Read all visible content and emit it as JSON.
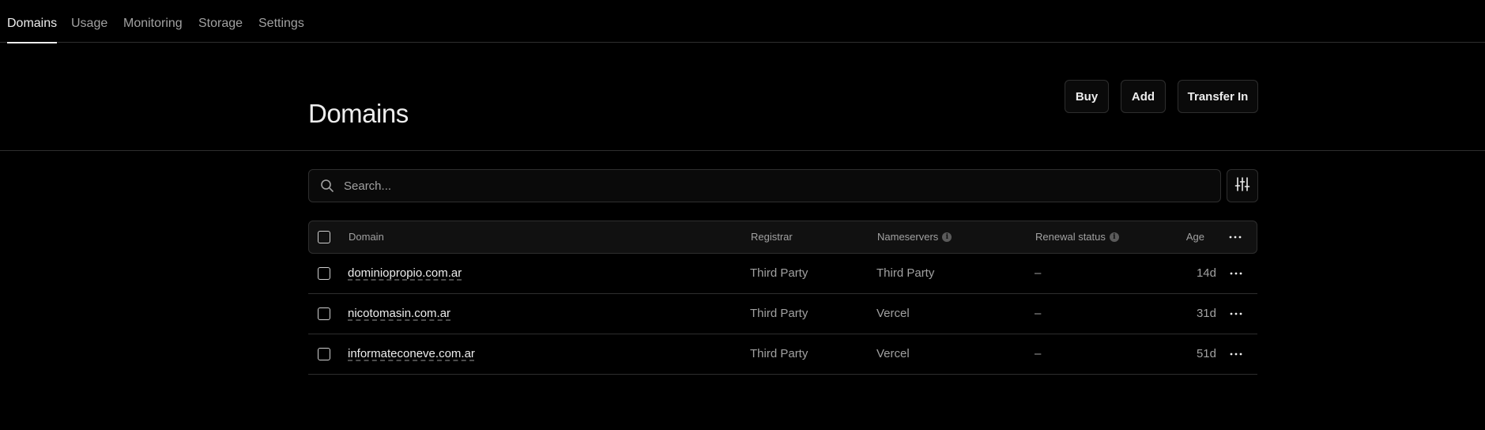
{
  "nav": {
    "tabs": [
      {
        "label": "Domains",
        "active": true
      },
      {
        "label": "Usage",
        "active": false
      },
      {
        "label": "Monitoring",
        "active": false
      },
      {
        "label": "Storage",
        "active": false
      },
      {
        "label": "Settings",
        "active": false
      }
    ]
  },
  "header": {
    "title": "Domains",
    "buttons": {
      "buy": "Buy",
      "add": "Add",
      "transfer_in": "Transfer In"
    }
  },
  "search": {
    "placeholder": "Search...",
    "value": ""
  },
  "table": {
    "columns": {
      "domain": "Domain",
      "registrar": "Registrar",
      "nameservers": "Nameservers",
      "renewal_status": "Renewal status",
      "age": "Age"
    },
    "rows": [
      {
        "domain": "dominiopropio.com.ar",
        "registrar": "Third Party",
        "nameservers": "Third Party",
        "renewal_status": "–",
        "age": "14d"
      },
      {
        "domain": "nicotomasin.com.ar",
        "registrar": "Third Party",
        "nameservers": "Vercel",
        "renewal_status": "–",
        "age": "31d"
      },
      {
        "domain": "informateconeve.com.ar",
        "registrar": "Third Party",
        "nameservers": "Vercel",
        "renewal_status": "–",
        "age": "51d"
      }
    ]
  },
  "icons": {
    "search": "search-icon",
    "filter": "sliders-icon",
    "info": "info-icon",
    "more": "ellipsis-icon"
  },
  "colors": {
    "background": "#000000",
    "border": "#2e2e2e",
    "text_primary": "#ededed",
    "text_secondary": "#a1a1a1"
  }
}
